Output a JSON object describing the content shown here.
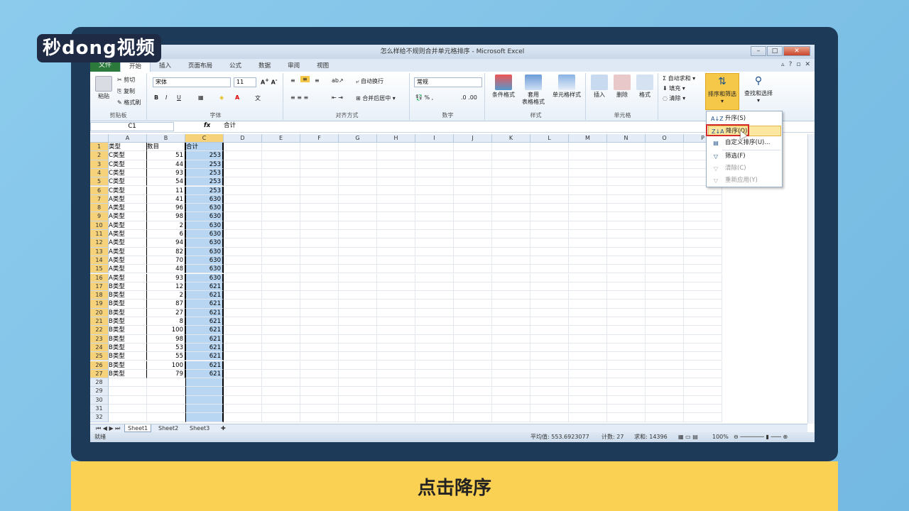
{
  "watermark": "秒dong视频",
  "caption": "点击降序",
  "window": {
    "title": "怎么样给不规则合并单元格排序 - Microsoft Excel",
    "buttons": [
      "–",
      "□",
      "✕"
    ]
  },
  "tabs": [
    "文件",
    "开始",
    "插入",
    "页面布局",
    "公式",
    "数据",
    "审阅",
    "视图"
  ],
  "ribbon": {
    "clipboard": {
      "label": "剪贴板",
      "paste": "粘贴",
      "cut": "剪切",
      "copy": "复制",
      "format_painter": "格式刷"
    },
    "font": {
      "label": "字体",
      "font_name": "宋体",
      "font_size": "11"
    },
    "alignment": {
      "label": "对齐方式",
      "wrap": "自动换行",
      "merge": "合并后居中"
    },
    "number": {
      "label": "数字",
      "format": "常规"
    },
    "styles": {
      "label": "样式",
      "conditional": "条件格式",
      "table_format_line1": "套用",
      "table_format_line2": "表格格式",
      "cell_styles": "单元格样式"
    },
    "cells": {
      "label": "单元格",
      "insert": "插入",
      "delete": "删除",
      "format": "格式"
    },
    "editing": {
      "autosum": "自动求和",
      "fill": "填充",
      "clear": "清除",
      "sort_filter": "排序和筛选",
      "find_select": "查找和选择"
    }
  },
  "formula_bar": {
    "name_box": "C1",
    "fx": "fx",
    "value": "合计"
  },
  "columns": [
    "A",
    "B",
    "C",
    "D",
    "E",
    "F",
    "G",
    "H",
    "I",
    "J",
    "K",
    "L",
    "M",
    "N",
    "O",
    "P"
  ],
  "rows": [
    {
      "n": "1",
      "a": "类型",
      "b": "数目",
      "c": "合计"
    },
    {
      "n": "2",
      "a": "C类型",
      "b": "51",
      "c": "253"
    },
    {
      "n": "3",
      "a": "C类型",
      "b": "44",
      "c": "253"
    },
    {
      "n": "4",
      "a": "C类型",
      "b": "93",
      "c": "253"
    },
    {
      "n": "5",
      "a": "C类型",
      "b": "54",
      "c": "253"
    },
    {
      "n": "6",
      "a": "C类型",
      "b": "11",
      "c": "253"
    },
    {
      "n": "7",
      "a": "A类型",
      "b": "41",
      "c": "630"
    },
    {
      "n": "8",
      "a": "A类型",
      "b": "96",
      "c": "630"
    },
    {
      "n": "9",
      "a": "A类型",
      "b": "98",
      "c": "630"
    },
    {
      "n": "10",
      "a": "A类型",
      "b": "2",
      "c": "630"
    },
    {
      "n": "11",
      "a": "A类型",
      "b": "6",
      "c": "630"
    },
    {
      "n": "12",
      "a": "A类型",
      "b": "94",
      "c": "630"
    },
    {
      "n": "13",
      "a": "A类型",
      "b": "82",
      "c": "630"
    },
    {
      "n": "14",
      "a": "A类型",
      "b": "70",
      "c": "630"
    },
    {
      "n": "15",
      "a": "A类型",
      "b": "48",
      "c": "630"
    },
    {
      "n": "16",
      "a": "A类型",
      "b": "93",
      "c": "630"
    },
    {
      "n": "17",
      "a": "B类型",
      "b": "12",
      "c": "621"
    },
    {
      "n": "18",
      "a": "B类型",
      "b": "2",
      "c": "621"
    },
    {
      "n": "19",
      "a": "B类型",
      "b": "87",
      "c": "621"
    },
    {
      "n": "20",
      "a": "B类型",
      "b": "27",
      "c": "621"
    },
    {
      "n": "21",
      "a": "B类型",
      "b": "8",
      "c": "621"
    },
    {
      "n": "22",
      "a": "B类型",
      "b": "100",
      "c": "621"
    },
    {
      "n": "23",
      "a": "B类型",
      "b": "98",
      "c": "621"
    },
    {
      "n": "24",
      "a": "B类型",
      "b": "53",
      "c": "621"
    },
    {
      "n": "25",
      "a": "B类型",
      "b": "55",
      "c": "621"
    },
    {
      "n": "26",
      "a": "B类型",
      "b": "100",
      "c": "621"
    },
    {
      "n": "27",
      "a": "B类型",
      "b": "79",
      "c": "621"
    },
    {
      "n": "28",
      "a": "",
      "b": "",
      "c": ""
    },
    {
      "n": "29",
      "a": "",
      "b": "",
      "c": ""
    },
    {
      "n": "30",
      "a": "",
      "b": "",
      "c": ""
    },
    {
      "n": "31",
      "a": "",
      "b": "",
      "c": ""
    },
    {
      "n": "32",
      "a": "",
      "b": "",
      "c": ""
    }
  ],
  "sheets": [
    "Sheet1",
    "Sheet2",
    "Sheet3"
  ],
  "status": {
    "ready": "就绪",
    "average": "平均值: 553.6923077",
    "count": "计数: 27",
    "sum": "求和: 14396",
    "zoom": "100%"
  },
  "sort_menu": {
    "ascending": "升序(S)",
    "descending": "降序(O)",
    "custom": "自定义排序(U)...",
    "filter": "筛选(F)",
    "clear": "清除(C)",
    "reapply": "重新应用(Y)"
  }
}
